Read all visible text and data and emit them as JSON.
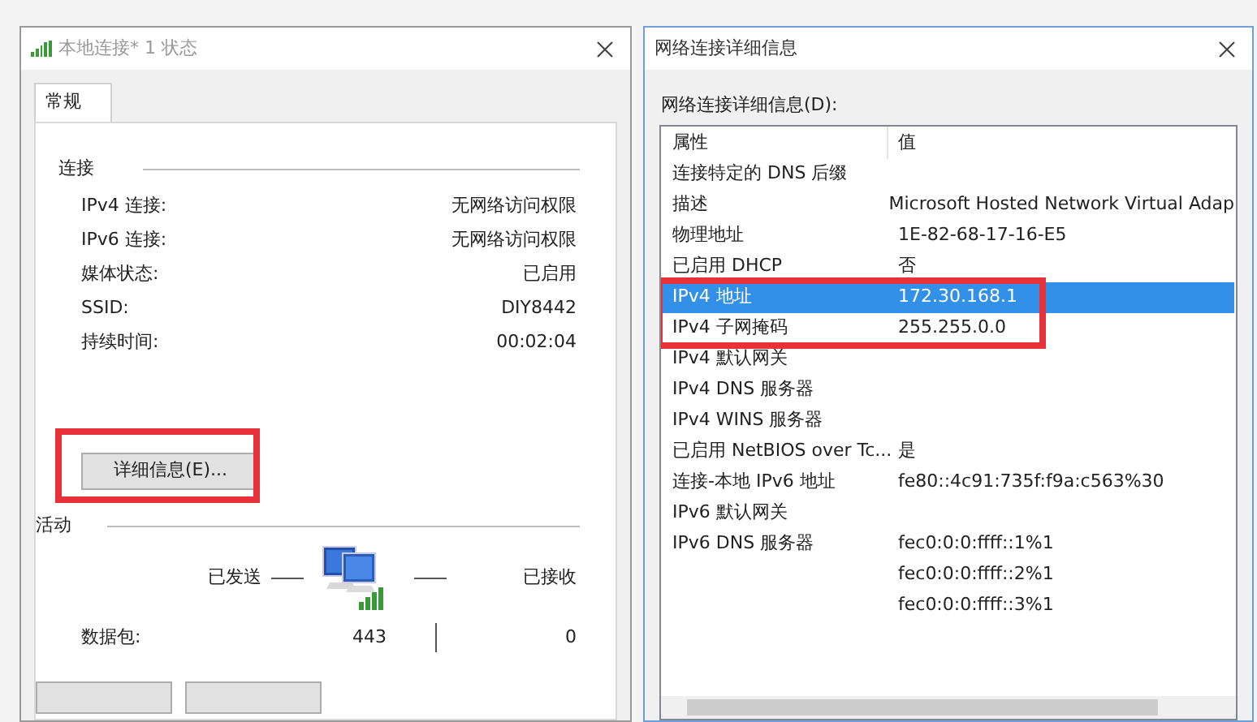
{
  "status_window": {
    "title": "本地连接* 1 状态",
    "tabs": [
      {
        "label": "常规",
        "selected": true
      }
    ],
    "connection": {
      "heading": "连接",
      "rows": [
        {
          "label": "IPv4 连接:",
          "value": "无网络访问权限"
        },
        {
          "label": "IPv6 连接:",
          "value": "无网络访问权限"
        },
        {
          "label": "媒体状态:",
          "value": "已启用"
        },
        {
          "label": "SSID:",
          "value": "DIY8442"
        },
        {
          "label": "持续时间:",
          "value": "00:02:04"
        }
      ]
    },
    "details_button": {
      "label": "详细信息(E)...",
      "highlighted": true
    },
    "activity": {
      "heading": "活动",
      "sent_label": "已发送",
      "received_label": "已接收",
      "packets_label": "数据包:",
      "packets_sent": "443",
      "packets_received": "0"
    }
  },
  "details_window": {
    "title": "网络连接详细信息",
    "list_label": "网络连接详细信息(D):",
    "columns": [
      "属性",
      "值"
    ],
    "rows": [
      {
        "property": "连接特定的 DNS 后缀",
        "value": "",
        "selected": false,
        "highlighted": false
      },
      {
        "property": "描述",
        "value": "Microsoft Hosted Network Virtual Adap",
        "selected": false,
        "highlighted": false
      },
      {
        "property": "物理地址",
        "value": "1E-82-68-17-16-E5",
        "selected": false,
        "highlighted": false
      },
      {
        "property": "已启用 DHCP",
        "value": "否",
        "selected": false,
        "highlighted": false
      },
      {
        "property": "IPv4 地址",
        "value": "172.30.168.1",
        "selected": true,
        "highlighted": true
      },
      {
        "property": "IPv4 子网掩码",
        "value": "255.255.0.0",
        "selected": false,
        "highlighted": true
      },
      {
        "property": "IPv4 默认网关",
        "value": "",
        "selected": false,
        "highlighted": false
      },
      {
        "property": "IPv4 DNS 服务器",
        "value": "",
        "selected": false,
        "highlighted": false
      },
      {
        "property": "IPv4 WINS 服务器",
        "value": "",
        "selected": false,
        "highlighted": false
      },
      {
        "property": "已启用 NetBIOS over Tc...",
        "value": "是",
        "selected": false,
        "highlighted": false
      },
      {
        "property": "连接-本地 IPv6 地址",
        "value": "fe80::4c91:735f:f9a:c563%30",
        "selected": false,
        "highlighted": false
      },
      {
        "property": "IPv6 默认网关",
        "value": "",
        "selected": false,
        "highlighted": false
      },
      {
        "property": "IPv6 DNS 服务器",
        "value": "fec0:0:0:ffff::1%1",
        "selected": false,
        "highlighted": false
      },
      {
        "property": "",
        "value": "fec0:0:0:ffff::2%1",
        "selected": false,
        "highlighted": false
      },
      {
        "property": "",
        "value": "fec0:0:0:ffff::3%1",
        "selected": false,
        "highlighted": false
      }
    ]
  }
}
